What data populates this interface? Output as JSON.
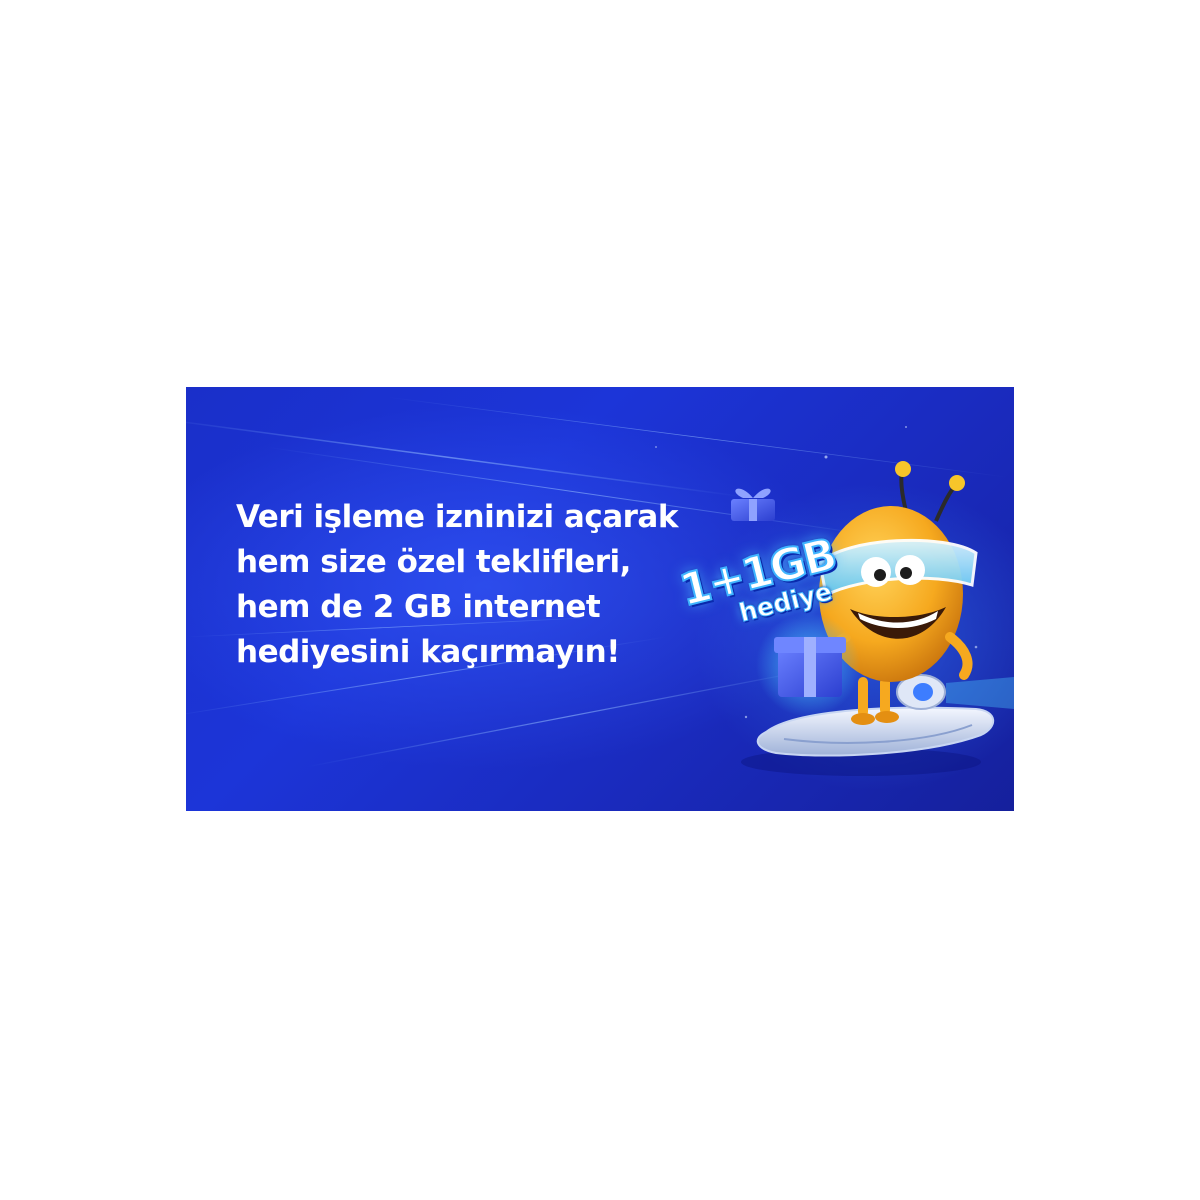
{
  "banner": {
    "headline_lines": [
      "Veri işleme izninizi açarak",
      "hem size özel teklifleri,",
      "hem de 2 GB internet",
      "hediyesini kaçırmayın!"
    ],
    "promo_badge": {
      "main": "1+1GB",
      "sub": "hediye"
    },
    "colors": {
      "background": "#1c35d8",
      "text": "#ffffff",
      "mascot": "#f6a91f",
      "gift": "#4c63f5"
    },
    "icons": [
      "gift-bow-icon",
      "mascot-character",
      "gift-box-icon",
      "hoverboard-illustration"
    ]
  }
}
